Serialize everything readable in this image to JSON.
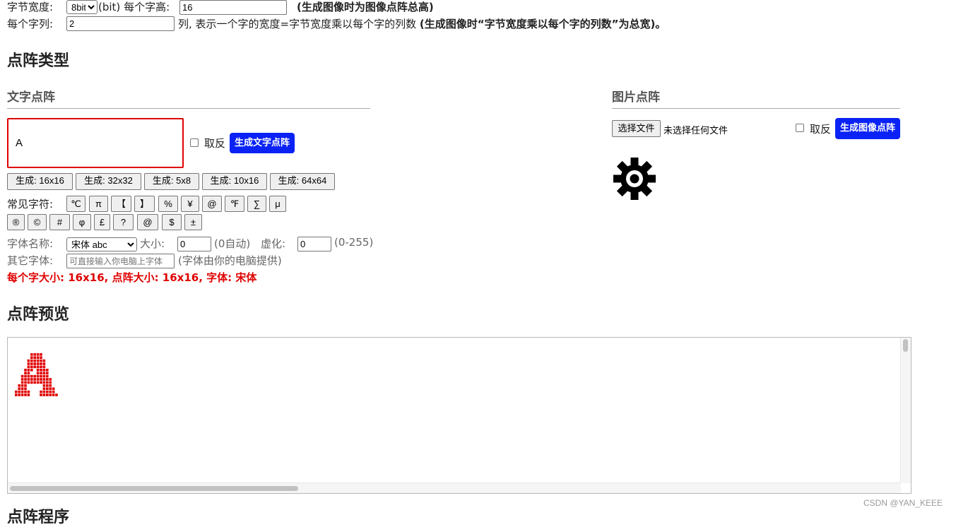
{
  "settings": {
    "byte_width_label": "字节宽度:",
    "byte_width_value": "8bit",
    "byte_width_options": [
      "8bit"
    ],
    "bit_unit": "(bit)",
    "char_height_label": "每个字高:",
    "char_height_value": "16",
    "char_height_note": "(生成图像时为图像点阵总高)",
    "char_cols_label": "每个字列:",
    "char_cols_value": "2",
    "char_cols_desc": "列, 表示一个字的宽度=字节宽度乘以每个字的列数",
    "char_cols_note": "(生成图像时“字节宽度乘以每个字的列数”为总宽)。"
  },
  "matrix_type": {
    "title": "点阵类型",
    "text_section": {
      "title": "文字点阵",
      "text_value": "A",
      "invert_label": "取反",
      "generate_button": "生成文字点阵",
      "size_buttons": [
        "生成: 16x16",
        "生成: 32x32",
        "生成: 5x8",
        "生成: 10x16",
        "生成: 64x64"
      ],
      "common_chars_label": "常见字符:",
      "symbols_row1": [
        "℃",
        "π",
        "【",
        "】",
        "%",
        "¥",
        "@",
        "℉",
        "∑",
        "μ"
      ],
      "symbols_row2": [
        "®",
        "©",
        "#",
        "φ",
        "£",
        "?",
        "@",
        "$",
        "±"
      ],
      "font_name_label": "字体名称:",
      "font_select_value": "宋体 abc",
      "font_options": [
        "宋体 abc"
      ],
      "size_label": "大小:",
      "size_value": "0",
      "size_note": "(0自动)",
      "blur_label": "虚化:",
      "blur_value": "0",
      "blur_note": "(0-255)",
      "other_font_label": "其它字体:",
      "other_font_placeholder": "可直接输入你电脑上字体",
      "other_font_note": "(字体由你的电脑提供)",
      "status": "每个字大小: 16x16, 点阵大小: 16x16, 字体: 宋体"
    },
    "image_section": {
      "title": "图片点阵",
      "choose_file_button": "选择文件",
      "no_file_text": "未选择任何文件",
      "invert_label": "取反",
      "generate_button": "生成图像点阵",
      "preview_icon": "gear-icon"
    }
  },
  "preview": {
    "title": "点阵预览",
    "pixel_color": "#e00000",
    "pixels": [
      "0000011110000000",
      "0000011110000000",
      "0000111111000000",
      "0000111111000000",
      "0000111111000000",
      "0001110111100000",
      "0001100111100000",
      "0011111111100000",
      "0011111111110000",
      "0011111111110000",
      "0111000001110000",
      "0111000001111000",
      "1111100011111000",
      "1111100011111100",
      "0000000000000000",
      "0000000000000000"
    ]
  },
  "next_section_title": "点阵程序",
  "watermark": "CSDN @YAN_KEEE",
  "colors": {
    "accent_blue": "#0a22f5",
    "status_red": "#e00000",
    "input_border_red": "#e00000"
  }
}
